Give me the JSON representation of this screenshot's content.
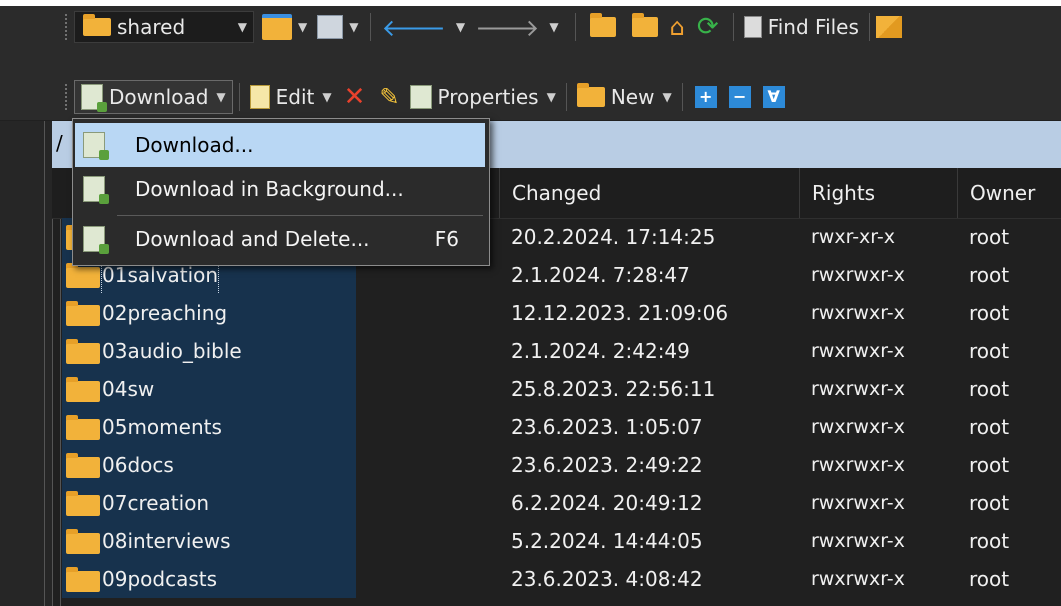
{
  "toolbar1": {
    "location": "shared",
    "find_files": "Find Files"
  },
  "toolbar2": {
    "download": "Download",
    "edit": "Edit",
    "properties": "Properties",
    "new": "New"
  },
  "menu": {
    "items": [
      {
        "label": "Download..."
      },
      {
        "label": "Download in Background..."
      },
      {
        "label": "Download and Delete...",
        "shortcut": "F6"
      }
    ]
  },
  "pathbar": {
    "text": "/"
  },
  "columns": {
    "changed": "Changed",
    "rights": "Rights",
    "owner": "Owner"
  },
  "files": [
    {
      "name": "",
      "changed": "20.2.2024. 17:14:25",
      "rights": "rwxr-xr-x",
      "owner": "root"
    },
    {
      "name": "01salvation",
      "changed": "2.1.2024. 7:28:47",
      "rights": "rwxrwxr-x",
      "owner": "root"
    },
    {
      "name": "02preaching",
      "changed": "12.12.2023. 21:09:06",
      "rights": "rwxrwxr-x",
      "owner": "root"
    },
    {
      "name": "03audio_bible",
      "changed": "2.1.2024. 2:42:49",
      "rights": "rwxrwxr-x",
      "owner": "root"
    },
    {
      "name": "04sw",
      "changed": "25.8.2023. 22:56:11",
      "rights": "rwxrwxr-x",
      "owner": "root"
    },
    {
      "name": "05moments",
      "changed": "23.6.2023. 1:05:07",
      "rights": "rwxrwxr-x",
      "owner": "root"
    },
    {
      "name": "06docs",
      "changed": "23.6.2023. 2:49:22",
      "rights": "rwxrwxr-x",
      "owner": "root"
    },
    {
      "name": "07creation",
      "changed": "6.2.2024. 20:49:12",
      "rights": "rwxrwxr-x",
      "owner": "root"
    },
    {
      "name": "08interviews",
      "changed": "5.2.2024. 14:44:05",
      "rights": "rwxrwxr-x",
      "owner": "root"
    },
    {
      "name": "09podcasts",
      "changed": "23.6.2023. 4:08:42",
      "rights": "rwxrwxr-x",
      "owner": "root"
    }
  ]
}
